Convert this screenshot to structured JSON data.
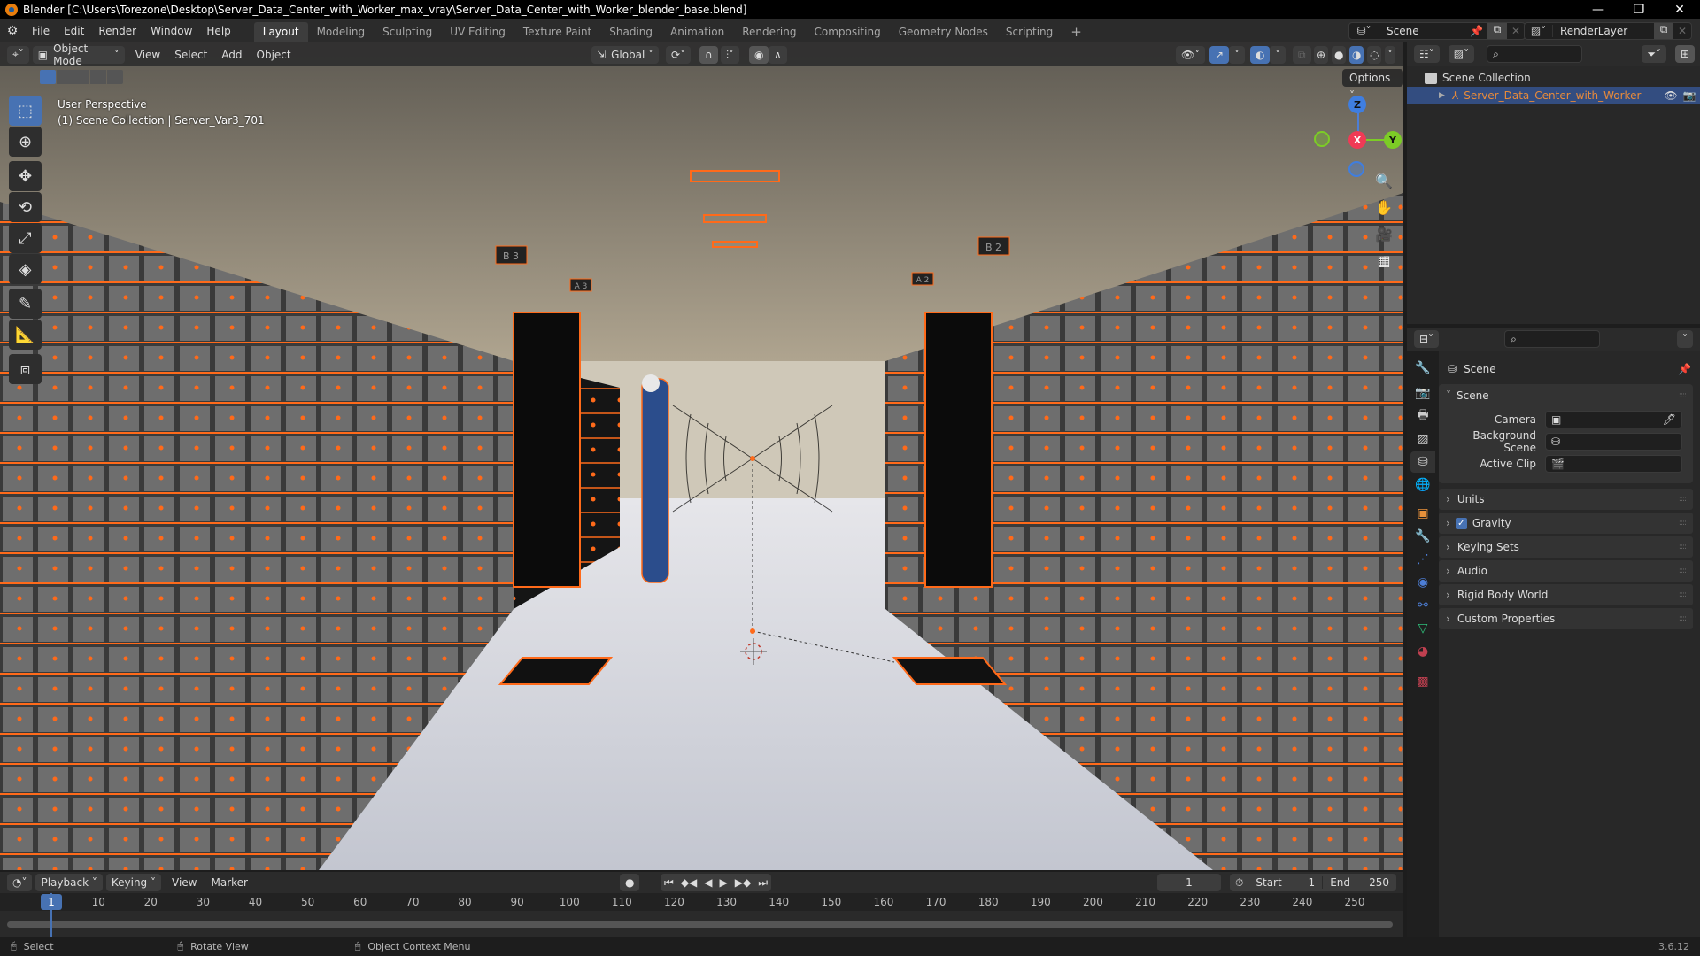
{
  "window": {
    "title": "Blender [C:\\Users\\Torezone\\Desktop\\Server_Data_Center_with_Worker_max_vray\\Server_Data_Center_with_Worker_blender_base.blend]",
    "controls": {
      "minimize": "—",
      "restore": "❐",
      "close": "✕"
    }
  },
  "topbar": {
    "menus": [
      "File",
      "Edit",
      "Render",
      "Window",
      "Help"
    ],
    "workspaces": [
      "Layout",
      "Modeling",
      "Sculpting",
      "UV Editing",
      "Texture Paint",
      "Shading",
      "Animation",
      "Rendering",
      "Compositing",
      "Geometry Nodes",
      "Scripting"
    ],
    "active_workspace": "Layout",
    "add_workspace": "+",
    "scene_name": "Scene",
    "view_layer": "RenderLayer"
  },
  "viewport": {
    "mode": "Object Mode",
    "menus": [
      "View",
      "Select",
      "Add",
      "Object"
    ],
    "transform_orientation": "Global",
    "options_label": "Options",
    "overlay_text_line1": "User Perspective",
    "overlay_text_line2": "(1) Scene Collection | Server_Var3_701",
    "gizmo": {
      "x": "X",
      "y": "Y",
      "z": "Z"
    },
    "shading_active": "solid-material-preview",
    "tools": [
      "select-box",
      "cursor",
      "move",
      "rotate",
      "scale",
      "transform",
      "annotate",
      "measure",
      "add-cube"
    ],
    "scene_labels": [
      "B 3",
      "A 3",
      "B 2",
      "A 2"
    ]
  },
  "outliner": {
    "root": "Scene Collection",
    "items": [
      {
        "name": "Server_Data_Center_with_Worker",
        "selected": true
      }
    ]
  },
  "properties": {
    "context": "Scene",
    "section_scene": "Scene",
    "fields": [
      {
        "label": "Camera",
        "value": ""
      },
      {
        "label": "Background Scene",
        "value": ""
      },
      {
        "label": "Active Clip",
        "value": ""
      }
    ],
    "panels": [
      "Units",
      "Gravity",
      "Keying Sets",
      "Audio",
      "Rigid Body World",
      "Custom Properties"
    ],
    "gravity_checked": true
  },
  "timeline": {
    "menus": [
      "Playback",
      "Keying",
      "View",
      "Marker"
    ],
    "current_frame": "1",
    "start_label": "Start",
    "start": "1",
    "end_label": "End",
    "end": "250",
    "ticks": [
      "1",
      "10",
      "20",
      "30",
      "40",
      "50",
      "60",
      "70",
      "80",
      "90",
      "100",
      "110",
      "120",
      "130",
      "140",
      "150",
      "160",
      "170",
      "180",
      "190",
      "200",
      "210",
      "220",
      "230",
      "240",
      "250"
    ]
  },
  "statusbar": {
    "select": "Select",
    "rotate": "Rotate View",
    "context_menu": "Object Context Menu",
    "version": "3.6.12"
  },
  "colors": {
    "accent_blue": "#4772b3",
    "selection_orange": "#ff6a1a",
    "outliner_selected_text": "#e98b3a"
  }
}
